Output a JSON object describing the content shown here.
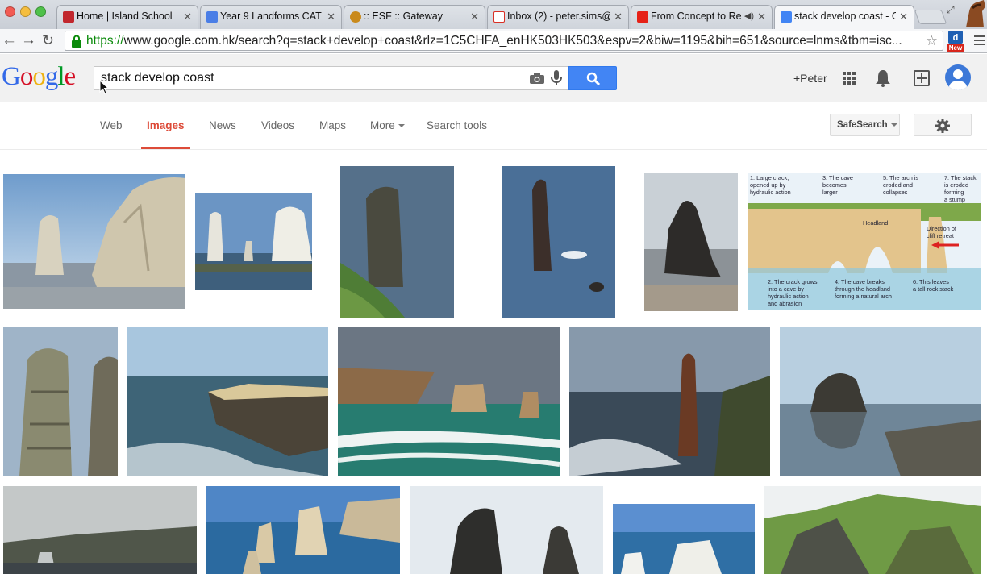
{
  "browser": {
    "tabs": [
      {
        "label": "Home | Island School",
        "favicon_color": "#c1272d"
      },
      {
        "label": "Year 9 Landforms CAT",
        "favicon_color": "#4a7ee6"
      },
      {
        "label": ":: ESF :: Gateway",
        "favicon_color": "#c98a1c"
      },
      {
        "label": "Inbox (2) - peter.sims@",
        "favicon_color": "#d93025"
      },
      {
        "label": "From Concept to Re",
        "favicon_color": "#e62117"
      },
      {
        "label": "stack develop coast - G",
        "favicon_color": "#4285f4"
      }
    ],
    "url_scheme": "https://",
    "url_rest": "www.google.com.hk/search?q=stack+develop+coast&rlz=1C5CHFA_enHK503HK503&espv=2&biw=1195&bih=651&source=lnms&tbm=isc...",
    "extension_badge": "New"
  },
  "google": {
    "query": "stack develop coast",
    "user": "+Peter",
    "nav": [
      {
        "label": "Web",
        "active": false
      },
      {
        "label": "Images",
        "active": true
      },
      {
        "label": "News",
        "active": false
      },
      {
        "label": "Videos",
        "active": false
      },
      {
        "label": "Maps",
        "active": false
      },
      {
        "label": "More",
        "active": false
      },
      {
        "label": "Search tools",
        "active": false
      }
    ],
    "safesearch_label": "SafeSearch"
  },
  "diagram": {
    "labels": [
      "1. Large crack, opened up by hydraulic action",
      "3. The cave becomes larger",
      "5. The arch is eroded and collapses",
      "7. The stack is eroded forming a stump",
      "Headland",
      "Direction of cliff retreat",
      "2. The crack grows into a cave by hydraulic action and abrasion",
      "4. The cave breaks through the headland forming a natural arch",
      "6. This leaves a tall rock stack"
    ]
  },
  "colors": {
    "google_blue": "#4285f4",
    "active_red": "#dd4b39",
    "url_green": "#0a8a0a"
  }
}
